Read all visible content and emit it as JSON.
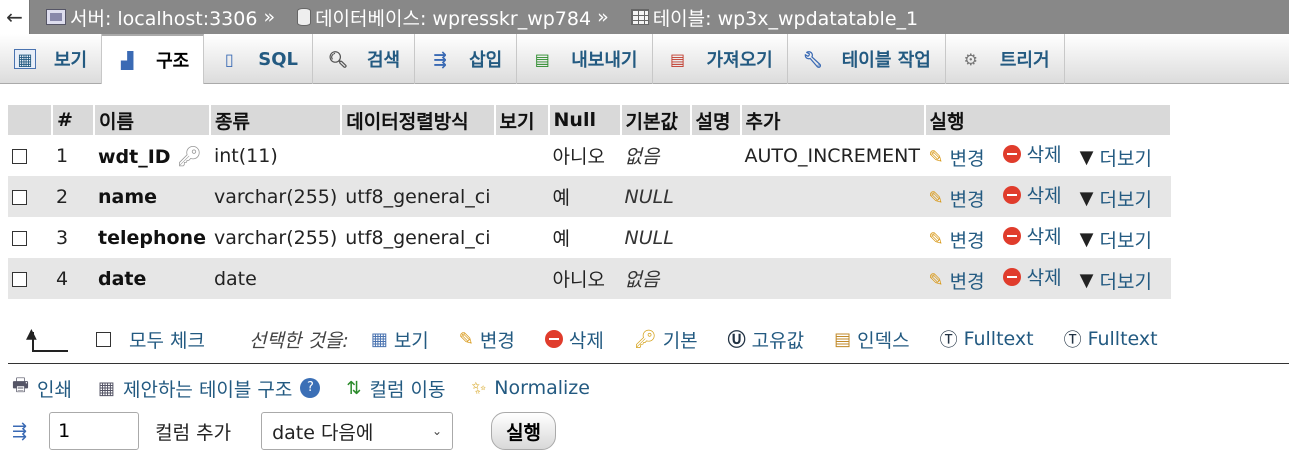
{
  "breadcrumb": {
    "back_label": "←",
    "server_label": "서버: localhost:3306",
    "db_label": "데이터베이스: wpresskr_wp784",
    "table_label": "테이블: wp3x_wpdatatable_1",
    "separator": "»"
  },
  "tabs": [
    {
      "label": "보기",
      "icon": "table-view-icon"
    },
    {
      "label": "구조",
      "icon": "structure-icon",
      "active": true
    },
    {
      "label": "SQL",
      "icon": "sql-icon"
    },
    {
      "label": "검색",
      "icon": "search-icon"
    },
    {
      "label": "삽입",
      "icon": "insert-icon"
    },
    {
      "label": "내보내기",
      "icon": "export-icon"
    },
    {
      "label": "가져오기",
      "icon": "import-icon"
    },
    {
      "label": "테이블 작업",
      "icon": "wrench-icon"
    },
    {
      "label": "트리거",
      "icon": "trigger-icon"
    }
  ],
  "structure": {
    "headers": [
      "#",
      "이름",
      "종류",
      "데이터정렬방식",
      "보기",
      "Null",
      "기본값",
      "설명",
      "추가",
      "실행"
    ],
    "rows": [
      {
        "num": "1",
        "name": "wdt_ID",
        "type": "int(11)",
        "collation": "",
        "null": "아니오",
        "default": "없음",
        "comment": "",
        "extra": "AUTO_INCREMENT",
        "primary": true
      },
      {
        "num": "2",
        "name": "name",
        "type": "varchar(255)",
        "collation": "utf8_general_ci",
        "null": "예",
        "default": "NULL",
        "comment": "",
        "extra": ""
      },
      {
        "num": "3",
        "name": "telephone",
        "type": "varchar(255)",
        "collation": "utf8_general_ci",
        "null": "예",
        "default": "NULL",
        "comment": "",
        "extra": ""
      },
      {
        "num": "4",
        "name": "date",
        "type": "date",
        "collation": "",
        "null": "아니오",
        "default": "없음",
        "comment": "",
        "extra": ""
      }
    ],
    "actions": {
      "change": "변경",
      "drop": "삭제",
      "more": "더보기"
    }
  },
  "bulk": {
    "check_all": "모두 체크",
    "with_selected": "선택한 것을:",
    "items": [
      "보기",
      "변경",
      "삭제",
      "기본",
      "고유값",
      "인덱스",
      "Fulltext",
      "Fulltext"
    ]
  },
  "tools": {
    "print": "인쇄",
    "propose": "제안하는 테이블 구조",
    "move_columns": "컬럼 이동",
    "normalize": "Normalize"
  },
  "add_column": {
    "count": "1",
    "label": "컬럼 추가",
    "position": "date 다음에",
    "go": "실행"
  }
}
